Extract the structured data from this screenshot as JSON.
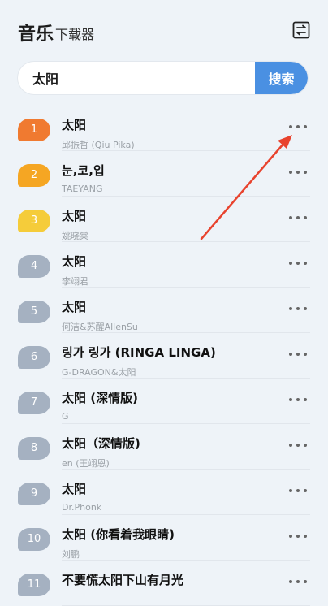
{
  "header": {
    "title": "音乐",
    "subtitle": "下载器",
    "swap_icon": "swap-icon"
  },
  "search": {
    "value": "太阳",
    "button_label": "搜索"
  },
  "results": [
    {
      "rank": "1",
      "title": "太阳",
      "artist": "邱振哲 (Qiu Pika)",
      "badge_color": "#f07a30"
    },
    {
      "rank": "2",
      "title": "눈,코,입",
      "artist": "TAEYANG",
      "badge_color": "#f5a623"
    },
    {
      "rank": "3",
      "title": "太阳",
      "artist": "姚晓棠",
      "badge_color": "#f5cc3a"
    },
    {
      "rank": "4",
      "title": "太阳",
      "artist": "李翊君",
      "badge_color": "#a5b1c1"
    },
    {
      "rank": "5",
      "title": "太阳",
      "artist": "何洁&苏醒AllenSu",
      "badge_color": "#a5b1c1"
    },
    {
      "rank": "6",
      "title": "링가 링가 (RINGA LINGA)",
      "artist": "G-DRAGON&太阳",
      "badge_color": "#a5b1c1"
    },
    {
      "rank": "7",
      "title": "太阳 (深情版)",
      "artist": "G",
      "badge_color": "#a5b1c1"
    },
    {
      "rank": "8",
      "title": "太阳（深情版)",
      "artist": "en (王翊恩)",
      "badge_color": "#a5b1c1"
    },
    {
      "rank": "9",
      "title": "太阳",
      "artist": "Dr.Phonk",
      "badge_color": "#a5b1c1"
    },
    {
      "rank": "10",
      "title": "太阳 (你看着我眼睛)",
      "artist": "刘鹏",
      "badge_color": "#a5b1c1"
    },
    {
      "rank": "11",
      "title": "不要慌太阳下山有月光",
      "artist": "",
      "badge_color": "#a5b1c1"
    }
  ],
  "colors": {
    "accent": "#4a90e2",
    "annotation_arrow": "#e8432e"
  }
}
